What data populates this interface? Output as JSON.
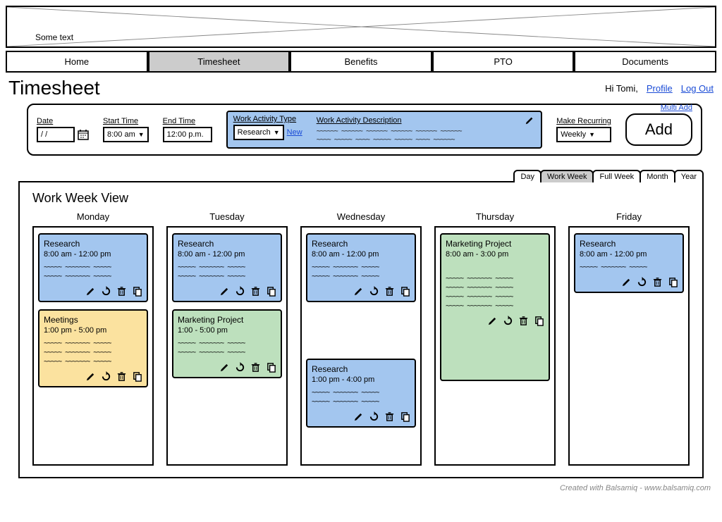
{
  "banner": {
    "text": "Some text"
  },
  "nav": {
    "items": [
      {
        "label": "Home"
      },
      {
        "label": "Timesheet"
      },
      {
        "label": "Benefits"
      },
      {
        "label": "PTO"
      },
      {
        "label": "Documents"
      }
    ]
  },
  "header": {
    "title": "Timesheet",
    "greeting": "Hi Tomi,",
    "profile": "Profile",
    "logout": "Log Out"
  },
  "toolbar": {
    "date_label": "Date",
    "date_value": "  /   /",
    "start_label": "Start Time",
    "start_value": "8:00 am",
    "end_label": "End Time",
    "end_value": "12:00 p.m.",
    "activity_type_label": "Work Activity Type",
    "activity_type_value": "Research",
    "new_link": "New",
    "activity_desc_label": "Work Activity Description",
    "recurring_label": "Make Recurring",
    "recurring_value": "Weekly",
    "multi_add": "Multi Add",
    "add": "Add"
  },
  "view": {
    "tabs": [
      {
        "label": "Day"
      },
      {
        "label": "Work Week"
      },
      {
        "label": "Full Week"
      },
      {
        "label": "Month"
      },
      {
        "label": "Year"
      }
    ],
    "title": "Work Week View",
    "days": [
      {
        "name": "Monday",
        "cards": [
          {
            "color": "blue",
            "title": "Research",
            "time": "8:00 am - 12:00 pm",
            "lines": 2
          },
          {
            "color": "yellow",
            "title": "Meetings",
            "time": "1:00 pm - 5:00 pm",
            "lines": 3
          }
        ]
      },
      {
        "name": "Tuesday",
        "cards": [
          {
            "color": "blue",
            "title": "Research",
            "time": "8:00 am - 12:00 pm",
            "lines": 2
          },
          {
            "color": "green",
            "title": "Marketing Project",
            "time": "1:00 - 5:00 pm",
            "lines": 2
          }
        ]
      },
      {
        "name": "Wednesday",
        "cards": [
          {
            "color": "blue",
            "title": "Research",
            "time": "8:00 am - 12:00 pm",
            "lines": 2
          },
          {
            "color": "blue",
            "title": "Research",
            "time": "1:00 pm - 4:00 pm",
            "lines": 2
          }
        ]
      },
      {
        "name": "Thursday",
        "cards": [
          {
            "color": "green",
            "title": "Marketing Project",
            "time": "8:00 am - 3:00 pm",
            "lines": 4,
            "tall": true
          }
        ]
      },
      {
        "name": "Friday",
        "cards": [
          {
            "color": "blue",
            "title": "Research",
            "time": "8:00 am - 12:00 pm",
            "lines": 1
          }
        ]
      }
    ]
  },
  "footer": {
    "credit": "Created with Balsamiq - www.balsamiq.com"
  }
}
